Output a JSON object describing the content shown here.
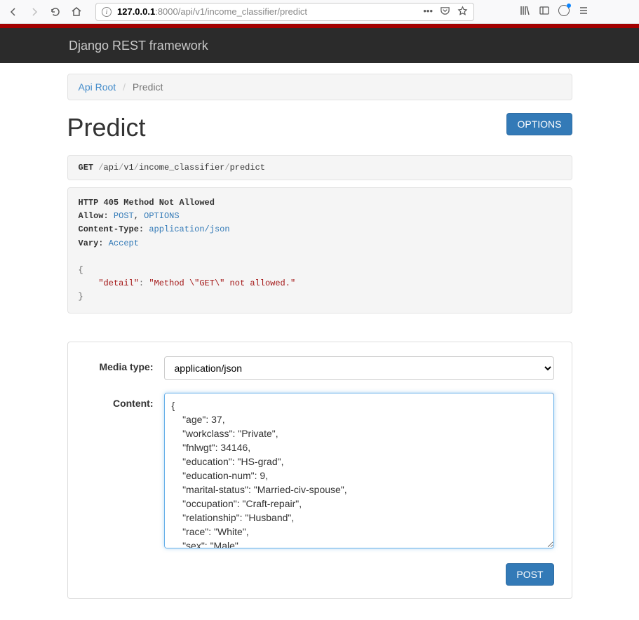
{
  "url": {
    "host": "127.0.0.1",
    "rest": ":8000/api/v1/income_classifier/predict"
  },
  "navbar": {
    "brand": "Django REST framework"
  },
  "breadcrumb": {
    "root": "Api Root",
    "current": "Predict"
  },
  "page": {
    "title": "Predict",
    "options_btn": "OPTIONS"
  },
  "request": {
    "method": "GET",
    "p1": "api",
    "p2": "v1",
    "p3": "income_classifier",
    "p4": "predict"
  },
  "response": {
    "status": "HTTP 405 Method Not Allowed",
    "allow_k": "Allow:",
    "allow_v1": "POST",
    "allow_sep": ", ",
    "allow_v2": "OPTIONS",
    "ct_k": "Content-Type:",
    "ct_v": "application/json",
    "vary_k": "Vary:",
    "vary_v": "Accept",
    "body_key": "\"detail\"",
    "body_colon": ":",
    "body_val": "\"Method \\\"GET\\\" not allowed.\""
  },
  "form": {
    "media_label": "Media type:",
    "media_value": "application/json",
    "content_label": "Content:",
    "content_value": "{\n    \"age\": 37,\n    \"workclass\": \"Private\",\n    \"fnlwgt\": 34146,\n    \"education\": \"HS-grad\",\n    \"education-num\": 9,\n    \"marital-status\": \"Married-civ-spouse\",\n    \"occupation\": \"Craft-repair\",\n    \"relationship\": \"Husband\",\n    \"race\": \"White\",\n    \"sex\": \"Male\",",
    "post_btn": "POST"
  }
}
